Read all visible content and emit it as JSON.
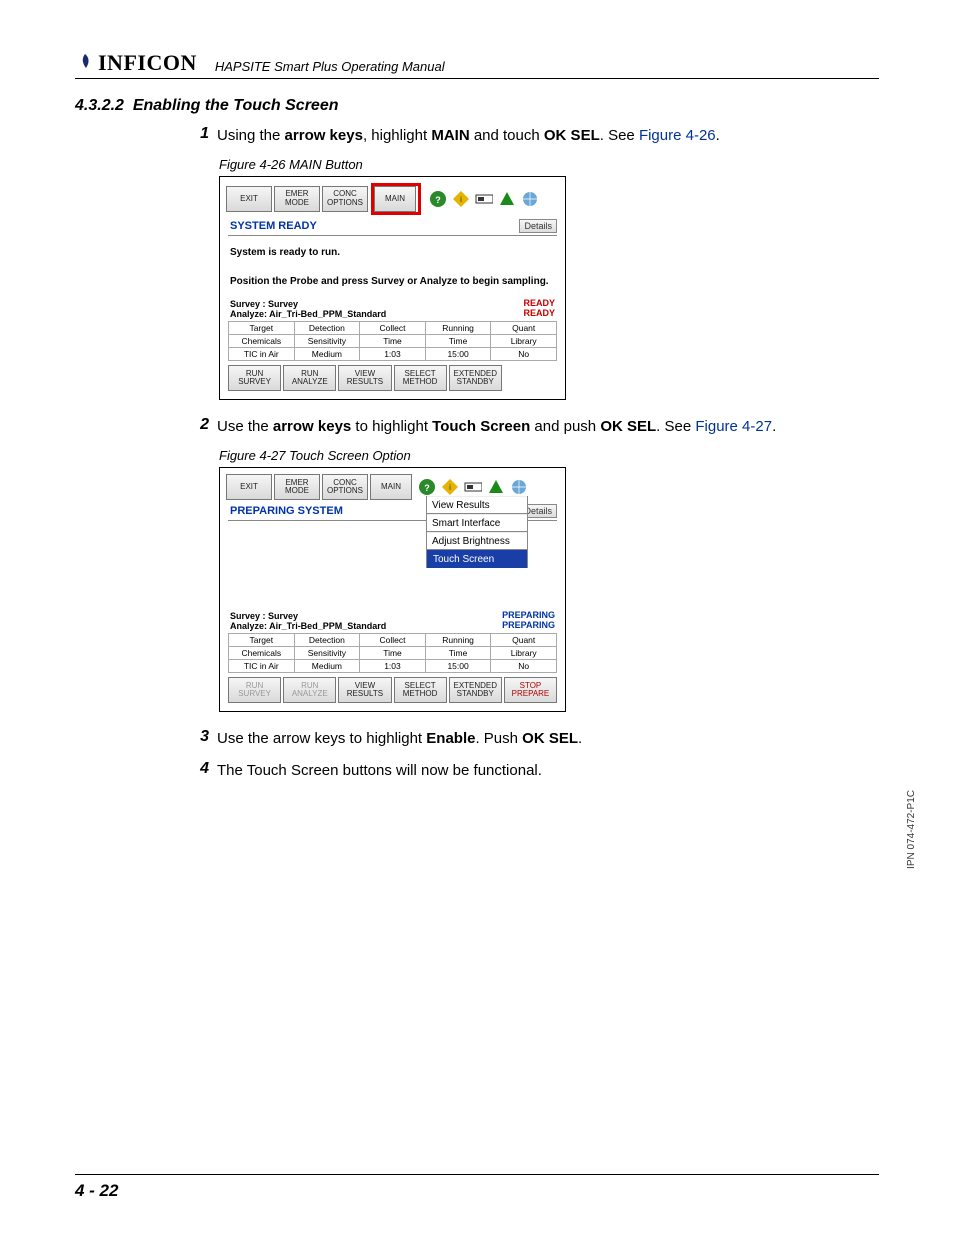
{
  "header": {
    "brand": "INFICON",
    "manual_title": "HAPSITE Smart Plus Operating Manual"
  },
  "section": {
    "number": "4.3.2.2",
    "title": "Enabling the Touch Screen"
  },
  "steps": [
    {
      "num": "1",
      "pre": "Using the ",
      "b1": "arrow keys",
      "mid1": ", highlight ",
      "b2": "MAIN",
      "mid2": " and touch ",
      "b3": "OK SEL",
      "post": ". See ",
      "xref": "Figure 4-26",
      "end": "."
    },
    {
      "num": "2",
      "pre": "Use the ",
      "b1": "arrow keys",
      "mid1": " to highlight ",
      "b2": "Touch Screen",
      "mid2": " and push ",
      "b3": "OK SEL",
      "post": ". See ",
      "xref": "Figure 4-27",
      "end": "."
    },
    {
      "num": "3",
      "plain_pre": "Use the arrow keys to highlight ",
      "b1": "Enable",
      "mid1": ". Push ",
      "b2": "OK SEL",
      "end": "."
    },
    {
      "num": "4",
      "plain": "The Touch Screen buttons will now be functional."
    }
  ],
  "fig26": {
    "caption": "Figure 4-26  MAIN Button",
    "top_buttons": [
      "EXIT",
      "EMER\nMODE",
      "CONC\nOPTIONS",
      "MAIN"
    ],
    "status": "SYSTEM READY",
    "details": "Details",
    "message": "System is ready to run.\n\nPosition the Probe and press Survey or Analyze to begin sampling.",
    "survey_lines": [
      "Survey : Survey",
      "Analyze: Air_Tri-Bed_PPM_Standard"
    ],
    "status_right": [
      "READY",
      "READY"
    ],
    "table": [
      [
        "Target",
        "Detection",
        "Collect",
        "Running",
        "Quant"
      ],
      [
        "Chemicals",
        "Sensitivity",
        "Time",
        "Time",
        "Library"
      ],
      [
        "TIC in Air",
        "Medium",
        "1:03",
        "15:00",
        "No"
      ]
    ],
    "bottom": [
      "RUN\nSURVEY",
      "RUN\nANALYZE",
      "VIEW\nRESULTS",
      "SELECT\nMETHOD",
      "EXTENDED\nSTANDBY"
    ]
  },
  "fig27": {
    "caption": "Figure 4-27  Touch Screen Option",
    "top_buttons": [
      "EXIT",
      "EMER\nMODE",
      "CONC\nOPTIONS",
      "MAIN"
    ],
    "status": "PREPARING SYSTEM",
    "details": "Details",
    "menu": [
      "View Results",
      "Smart Interface",
      "Adjust Brightness",
      "Touch Screen"
    ],
    "survey_lines": [
      "Survey : Survey",
      "Analyze: Air_Tri-Bed_PPM_Standard"
    ],
    "status_right": [
      "PREPARING",
      "PREPARING"
    ],
    "table": [
      [
        "Target",
        "Detection",
        "Collect",
        "Running",
        "Quant"
      ],
      [
        "Chemicals",
        "Sensitivity",
        "Time",
        "Time",
        "Library"
      ],
      [
        "TIC in Air",
        "Medium",
        "1:03",
        "15:00",
        "No"
      ]
    ],
    "bottom": [
      "RUN\nSURVEY",
      "RUN\nANALYZE",
      "VIEW\nRESULTS",
      "SELECT\nMETHOD",
      "EXTENDED\nSTANDBY",
      "STOP\nPREPARE"
    ]
  },
  "footer": {
    "page": "4 - 22",
    "ipn": "IPN 074-472-P1C"
  }
}
